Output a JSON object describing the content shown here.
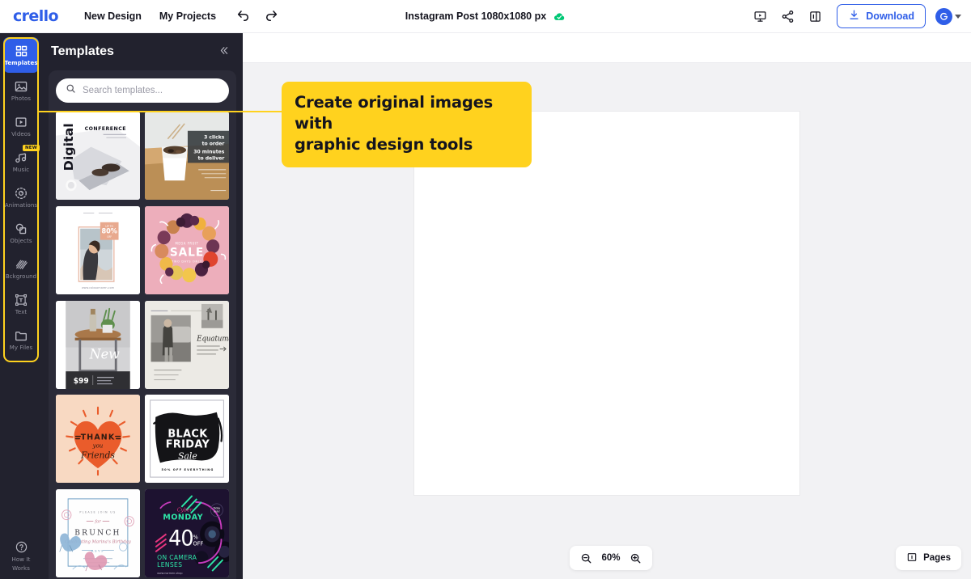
{
  "topbar": {
    "logo": "crello",
    "nav": [
      {
        "label": "New Design",
        "name": "nav-new-design"
      },
      {
        "label": "My Projects",
        "name": "nav-my-projects"
      }
    ],
    "undo": "undo-icon",
    "redo": "redo-icon",
    "doc_title": "Instagram Post 1080x1080 px",
    "sync_status_icon": "cloud-check-icon",
    "sync_color": "#00c775",
    "actions": [
      {
        "name": "present-icon",
        "label": "Present"
      },
      {
        "name": "share-icon",
        "label": "Share"
      },
      {
        "name": "duplicate-icon",
        "label": "Duplicate"
      }
    ],
    "download_label": "Download",
    "download_icon": "download-icon",
    "accent_color": "#2f5ee8",
    "avatar_icon": "user-avatar-icon",
    "caret_icon": "chevron-down-icon"
  },
  "rail": {
    "highlight_color": "#ffd21e",
    "items": [
      {
        "label": "Templates",
        "icon": "grid-squares-icon",
        "active": true,
        "badge": ""
      },
      {
        "label": "Photos",
        "icon": "image-icon",
        "active": false,
        "badge": ""
      },
      {
        "label": "Videos",
        "icon": "video-play-icon",
        "active": false,
        "badge": ""
      },
      {
        "label": "Music",
        "icon": "music-note-icon",
        "active": false,
        "badge": "NEW"
      },
      {
        "label": "Animations",
        "icon": "animation-icon",
        "active": false,
        "badge": ""
      },
      {
        "label": "Objects",
        "icon": "shapes-icon",
        "active": false,
        "badge": ""
      },
      {
        "label": "Bckground",
        "icon": "background-icon",
        "active": false,
        "badge": ""
      },
      {
        "label": "Text",
        "icon": "text-box-icon",
        "active": false,
        "badge": ""
      },
      {
        "label": "My Files",
        "icon": "folder-icon",
        "active": false,
        "badge": ""
      }
    ],
    "help": {
      "label_line1": "How It",
      "label_line2": "Works",
      "icon": "question-circle-icon"
    }
  },
  "panel": {
    "title": "Templates",
    "collapse_icon": "chevron-double-left-icon",
    "search": {
      "placeholder": "Search templates...",
      "value": "",
      "icon": "search-icon"
    },
    "templates": [
      {
        "name": "template-conference-digital",
        "alt": "Digital Conference"
      },
      {
        "name": "template-food-delivery",
        "alt": "3 clicks to order"
      },
      {
        "name": "template-fashion-80-off",
        "alt": "Up to 80% off"
      },
      {
        "name": "template-fruit-sale",
        "alt": "Fruit Sale"
      },
      {
        "name": "template-new-furniture",
        "alt": "New $99"
      },
      {
        "name": "template-equatuman",
        "alt": "Equatuman"
      },
      {
        "name": "template-thank-you-friends",
        "alt": "Thank You Friends"
      },
      {
        "name": "template-black-friday",
        "alt": "Black Friday Sale"
      },
      {
        "name": "template-brunch-invite",
        "alt": "Brunch Invitation"
      },
      {
        "name": "template-cyber-monday",
        "alt": "Cyber Monday 40% Off"
      }
    ]
  },
  "callout": {
    "line1": "Create original images with",
    "line2": "graphic design tools",
    "bg_color": "#ffd21e"
  },
  "canvas": {
    "zoom": {
      "value": "60%",
      "out_icon": "zoom-out-icon",
      "in_icon": "zoom-in-icon"
    },
    "pages": {
      "label": "Pages",
      "icon": "pages-icon"
    }
  }
}
